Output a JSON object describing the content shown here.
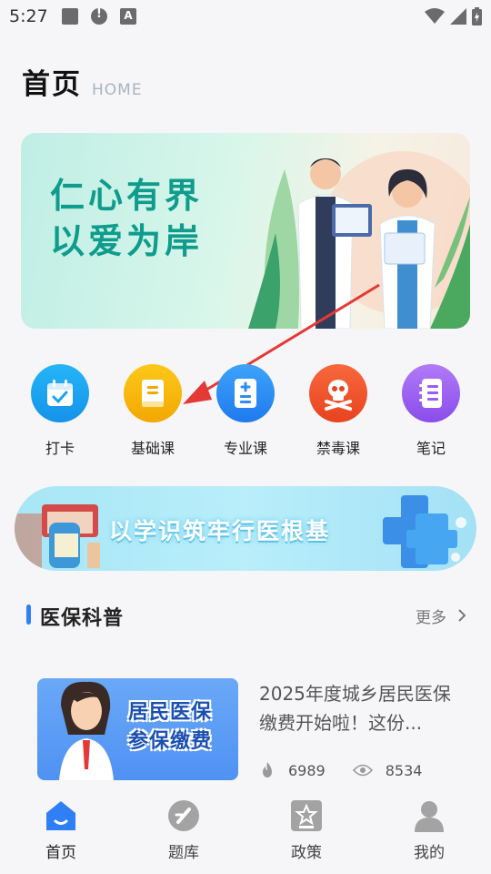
{
  "status_bar": {
    "time": "5:27"
  },
  "header": {
    "title": "首页",
    "subtitle": "HOME"
  },
  "banner": {
    "slogan_line1": "仁心有界",
    "slogan_line2": "以爱为岸"
  },
  "quick_menu": [
    {
      "label": "打卡",
      "icon": "calendar-check-icon",
      "color": "#1aa3f0"
    },
    {
      "label": "基础课",
      "icon": "book-icon",
      "color": "#f6b100"
    },
    {
      "label": "专业课",
      "icon": "document-plus-icon",
      "color": "#2e8df5"
    },
    {
      "label": "禁毒课",
      "icon": "skull-icon",
      "color": "#f0502a"
    },
    {
      "label": "笔记",
      "icon": "notebook-icon",
      "color": "#9a5cf0"
    }
  ],
  "banner2": {
    "text": "以学识筑牢行医根基"
  },
  "section": {
    "title": "医保科普",
    "more_label": "更多"
  },
  "news": {
    "thumb_title_line1": "居民医保",
    "thumb_title_line2": "参保缴费",
    "title": "2025年度城乡居民医保缴费开始啦！这份...",
    "likes": "6989",
    "views": "8534"
  },
  "bottom_nav": [
    {
      "label": "首页",
      "icon": "home-icon",
      "active": true
    },
    {
      "label": "题库",
      "icon": "question-bank-icon",
      "active": false
    },
    {
      "label": "政策",
      "icon": "policy-icon",
      "active": false
    },
    {
      "label": "我的",
      "icon": "user-icon",
      "active": false
    }
  ],
  "colors": {
    "accent": "#2f7ff7",
    "annotation": "#e53935"
  }
}
